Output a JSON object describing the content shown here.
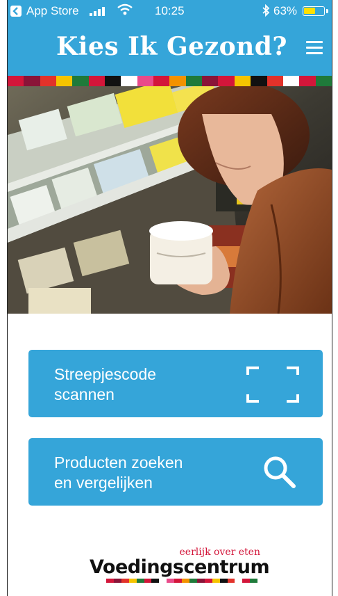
{
  "status_bar": {
    "back_app": "App Store",
    "time": "10:25",
    "battery_pct": "63%",
    "battery_level": 0.63
  },
  "header": {
    "title": "Kies Ik Gezond?",
    "menu_icon": "hamburger-menu-icon"
  },
  "colors": {
    "primary": "#35a5d9",
    "strip": [
      "#d3163a",
      "#8a1438",
      "#e2322a",
      "#f5c400",
      "#1f7a3a",
      "#d3163a",
      "#111111",
      "#ffffff",
      "#e94b8a",
      "#d3163a",
      "#f39200",
      "#1f7a3a",
      "#8a1438",
      "#d3163a",
      "#f5c400",
      "#111111",
      "#e2322a",
      "#ffffff",
      "#d3163a",
      "#1f7a3a"
    ]
  },
  "hero": {
    "alt": ""
  },
  "actions": {
    "scan": {
      "label_line1": "Streepjescode",
      "label_line2": "scannen",
      "icon": "barcode-scan-icon"
    },
    "search": {
      "label_line1": "Producten zoeken",
      "label_line2": "en vergelijken",
      "icon": "search-icon"
    }
  },
  "footer": {
    "tagline": "eerlijk over eten",
    "brand": "Voedingscentrum"
  }
}
